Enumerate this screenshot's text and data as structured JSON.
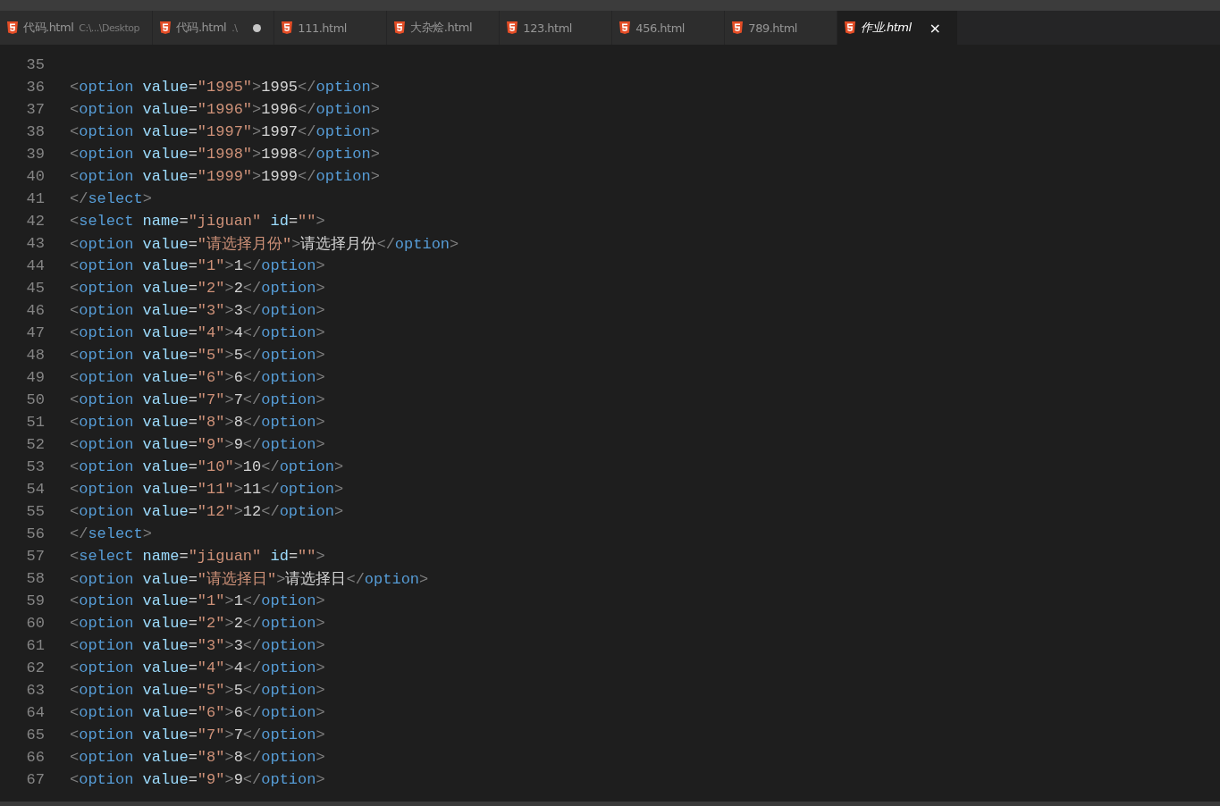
{
  "tabs": [
    {
      "label": "代码.html",
      "path": "C:\\...\\Desktop",
      "modified": false,
      "selected": false
    },
    {
      "label": "代码.html",
      "path": ".\\",
      "modified": true,
      "selected": false
    },
    {
      "label": "111.html",
      "modified": false,
      "selected": false
    },
    {
      "label": "大杂烩.html",
      "modified": false,
      "selected": false
    },
    {
      "label": "123.html",
      "modified": false,
      "selected": false
    },
    {
      "label": "456.html",
      "modified": false,
      "selected": false
    },
    {
      "label": "789.html",
      "modified": false,
      "selected": false
    },
    {
      "label": "作业.html",
      "modified": false,
      "selected": true,
      "close": "×"
    }
  ],
  "lines": [
    {
      "number": "35"
    },
    {
      "number": "36",
      "tokens": [
        {
          "kind": "punct",
          "text": "<"
        },
        {
          "kind": "tag",
          "text": "option"
        },
        {
          "kind": "attr",
          "text": " value"
        },
        {
          "kind": "eq",
          "text": "="
        },
        {
          "kind": "str",
          "text": "\"1995\""
        },
        {
          "kind": "punct",
          "text": ">"
        },
        {
          "kind": "text",
          "text": "1995"
        },
        {
          "kind": "punct",
          "text": "</"
        },
        {
          "kind": "tag",
          "text": "option"
        },
        {
          "kind": "punct",
          "text": ">"
        }
      ]
    },
    {
      "number": "37",
      "tokens": [
        {
          "kind": "punct",
          "text": "<"
        },
        {
          "kind": "tag",
          "text": "option"
        },
        {
          "kind": "attr",
          "text": " value"
        },
        {
          "kind": "eq",
          "text": "="
        },
        {
          "kind": "str",
          "text": "\"1996\""
        },
        {
          "kind": "punct",
          "text": ">"
        },
        {
          "kind": "text",
          "text": "1996"
        },
        {
          "kind": "punct",
          "text": "</"
        },
        {
          "kind": "tag",
          "text": "option"
        },
        {
          "kind": "punct",
          "text": ">"
        }
      ]
    },
    {
      "number": "38",
      "tokens": [
        {
          "kind": "punct",
          "text": "<"
        },
        {
          "kind": "tag",
          "text": "option"
        },
        {
          "kind": "attr",
          "text": " value"
        },
        {
          "kind": "eq",
          "text": "="
        },
        {
          "kind": "str",
          "text": "\"1997\""
        },
        {
          "kind": "punct",
          "text": ">"
        },
        {
          "kind": "text",
          "text": "1997"
        },
        {
          "kind": "punct",
          "text": "</"
        },
        {
          "kind": "tag",
          "text": "option"
        },
        {
          "kind": "punct",
          "text": ">"
        }
      ]
    },
    {
      "number": "39",
      "tokens": [
        {
          "kind": "punct",
          "text": "<"
        },
        {
          "kind": "tag",
          "text": "option"
        },
        {
          "kind": "attr",
          "text": " value"
        },
        {
          "kind": "eq",
          "text": "="
        },
        {
          "kind": "str",
          "text": "\"1998\""
        },
        {
          "kind": "punct",
          "text": ">"
        },
        {
          "kind": "text",
          "text": "1998"
        },
        {
          "kind": "punct",
          "text": "</"
        },
        {
          "kind": "tag",
          "text": "option"
        },
        {
          "kind": "punct",
          "text": ">"
        }
      ]
    },
    {
      "number": "40",
      "tokens": [
        {
          "kind": "punct",
          "text": "<"
        },
        {
          "kind": "tag",
          "text": "option"
        },
        {
          "kind": "attr",
          "text": " value"
        },
        {
          "kind": "eq",
          "text": "="
        },
        {
          "kind": "str",
          "text": "\"1999\""
        },
        {
          "kind": "punct",
          "text": ">"
        },
        {
          "kind": "text",
          "text": "1999"
        },
        {
          "kind": "punct",
          "text": "</"
        },
        {
          "kind": "tag",
          "text": "option"
        },
        {
          "kind": "punct",
          "text": ">"
        }
      ]
    },
    {
      "number": "41",
      "tokens": [
        {
          "kind": "punct",
          "text": "</"
        },
        {
          "kind": "tag",
          "text": "select"
        },
        {
          "kind": "punct",
          "text": ">"
        }
      ]
    },
    {
      "number": "42",
      "tokens": [
        {
          "kind": "punct",
          "text": "<"
        },
        {
          "kind": "tag",
          "text": "select"
        },
        {
          "kind": "attr",
          "text": " name"
        },
        {
          "kind": "eq",
          "text": "="
        },
        {
          "kind": "str",
          "text": "\"jiguan\""
        },
        {
          "kind": "attr",
          "text": " id"
        },
        {
          "kind": "eq",
          "text": "="
        },
        {
          "kind": "str",
          "text": "\"\""
        },
        {
          "kind": "punct",
          "text": ">"
        }
      ]
    },
    {
      "number": "43",
      "tokens": [
        {
          "kind": "punct",
          "text": "<"
        },
        {
          "kind": "tag",
          "text": "option"
        },
        {
          "kind": "attr",
          "text": " value"
        },
        {
          "kind": "eq",
          "text": "="
        },
        {
          "kind": "str",
          "text": "\"请选择月份\""
        },
        {
          "kind": "punct",
          "text": ">"
        },
        {
          "kind": "text",
          "text": "请选择月份"
        },
        {
          "kind": "punct",
          "text": "</"
        },
        {
          "kind": "tag",
          "text": "option"
        },
        {
          "kind": "punct",
          "text": ">"
        }
      ]
    },
    {
      "number": "44",
      "tokens": [
        {
          "kind": "punct",
          "text": "<"
        },
        {
          "kind": "tag",
          "text": "option"
        },
        {
          "kind": "attr",
          "text": " value"
        },
        {
          "kind": "eq",
          "text": "="
        },
        {
          "kind": "str",
          "text": "\"1\""
        },
        {
          "kind": "punct",
          "text": ">"
        },
        {
          "kind": "text",
          "text": "1"
        },
        {
          "kind": "punct",
          "text": "</"
        },
        {
          "kind": "tag",
          "text": "option"
        },
        {
          "kind": "punct",
          "text": ">"
        }
      ]
    },
    {
      "number": "45",
      "tokens": [
        {
          "kind": "punct",
          "text": "<"
        },
        {
          "kind": "tag",
          "text": "option"
        },
        {
          "kind": "attr",
          "text": " value"
        },
        {
          "kind": "eq",
          "text": "="
        },
        {
          "kind": "str",
          "text": "\"2\""
        },
        {
          "kind": "punct",
          "text": ">"
        },
        {
          "kind": "text",
          "text": "2"
        },
        {
          "kind": "punct",
          "text": "</"
        },
        {
          "kind": "tag",
          "text": "option"
        },
        {
          "kind": "punct",
          "text": ">"
        }
      ]
    },
    {
      "number": "46",
      "tokens": [
        {
          "kind": "punct",
          "text": "<"
        },
        {
          "kind": "tag",
          "text": "option"
        },
        {
          "kind": "attr",
          "text": " value"
        },
        {
          "kind": "eq",
          "text": "="
        },
        {
          "kind": "str",
          "text": "\"3\""
        },
        {
          "kind": "punct",
          "text": ">"
        },
        {
          "kind": "text",
          "text": "3"
        },
        {
          "kind": "punct",
          "text": "</"
        },
        {
          "kind": "tag",
          "text": "option"
        },
        {
          "kind": "punct",
          "text": ">"
        }
      ]
    },
    {
      "number": "47",
      "tokens": [
        {
          "kind": "punct",
          "text": "<"
        },
        {
          "kind": "tag",
          "text": "option"
        },
        {
          "kind": "attr",
          "text": " value"
        },
        {
          "kind": "eq",
          "text": "="
        },
        {
          "kind": "str",
          "text": "\"4\""
        },
        {
          "kind": "punct",
          "text": ">"
        },
        {
          "kind": "text",
          "text": "4"
        },
        {
          "kind": "punct",
          "text": "</"
        },
        {
          "kind": "tag",
          "text": "option"
        },
        {
          "kind": "punct",
          "text": ">"
        }
      ]
    },
    {
      "number": "48",
      "tokens": [
        {
          "kind": "punct",
          "text": "<"
        },
        {
          "kind": "tag",
          "text": "option"
        },
        {
          "kind": "attr",
          "text": " value"
        },
        {
          "kind": "eq",
          "text": "="
        },
        {
          "kind": "str",
          "text": "\"5\""
        },
        {
          "kind": "punct",
          "text": ">"
        },
        {
          "kind": "text",
          "text": "5"
        },
        {
          "kind": "punct",
          "text": "</"
        },
        {
          "kind": "tag",
          "text": "option"
        },
        {
          "kind": "punct",
          "text": ">"
        }
      ]
    },
    {
      "number": "49",
      "tokens": [
        {
          "kind": "punct",
          "text": "<"
        },
        {
          "kind": "tag",
          "text": "option"
        },
        {
          "kind": "attr",
          "text": " value"
        },
        {
          "kind": "eq",
          "text": "="
        },
        {
          "kind": "str",
          "text": "\"6\""
        },
        {
          "kind": "punct",
          "text": ">"
        },
        {
          "kind": "text",
          "text": "6"
        },
        {
          "kind": "punct",
          "text": "</"
        },
        {
          "kind": "tag",
          "text": "option"
        },
        {
          "kind": "punct",
          "text": ">"
        }
      ]
    },
    {
      "number": "50",
      "tokens": [
        {
          "kind": "punct",
          "text": "<"
        },
        {
          "kind": "tag",
          "text": "option"
        },
        {
          "kind": "attr",
          "text": " value"
        },
        {
          "kind": "eq",
          "text": "="
        },
        {
          "kind": "str",
          "text": "\"7\""
        },
        {
          "kind": "punct",
          "text": ">"
        },
        {
          "kind": "text",
          "text": "7"
        },
        {
          "kind": "punct",
          "text": "</"
        },
        {
          "kind": "tag",
          "text": "option"
        },
        {
          "kind": "punct",
          "text": ">"
        }
      ]
    },
    {
      "number": "51",
      "tokens": [
        {
          "kind": "punct",
          "text": "<"
        },
        {
          "kind": "tag",
          "text": "option"
        },
        {
          "kind": "attr",
          "text": " value"
        },
        {
          "kind": "eq",
          "text": "="
        },
        {
          "kind": "str",
          "text": "\"8\""
        },
        {
          "kind": "punct",
          "text": ">"
        },
        {
          "kind": "text",
          "text": "8"
        },
        {
          "kind": "punct",
          "text": "</"
        },
        {
          "kind": "tag",
          "text": "option"
        },
        {
          "kind": "punct",
          "text": ">"
        }
      ]
    },
    {
      "number": "52",
      "tokens": [
        {
          "kind": "punct",
          "text": "<"
        },
        {
          "kind": "tag",
          "text": "option"
        },
        {
          "kind": "attr",
          "text": " value"
        },
        {
          "kind": "eq",
          "text": "="
        },
        {
          "kind": "str",
          "text": "\"9\""
        },
        {
          "kind": "punct",
          "text": ">"
        },
        {
          "kind": "text",
          "text": "9"
        },
        {
          "kind": "punct",
          "text": "</"
        },
        {
          "kind": "tag",
          "text": "option"
        },
        {
          "kind": "punct",
          "text": ">"
        }
      ]
    },
    {
      "number": "53",
      "tokens": [
        {
          "kind": "punct",
          "text": "<"
        },
        {
          "kind": "tag",
          "text": "option"
        },
        {
          "kind": "attr",
          "text": " value"
        },
        {
          "kind": "eq",
          "text": "="
        },
        {
          "kind": "str",
          "text": "\"10\""
        },
        {
          "kind": "punct",
          "text": ">"
        },
        {
          "kind": "text",
          "text": "10"
        },
        {
          "kind": "punct",
          "text": "</"
        },
        {
          "kind": "tag",
          "text": "option"
        },
        {
          "kind": "punct",
          "text": ">"
        }
      ]
    },
    {
      "number": "54",
      "tokens": [
        {
          "kind": "punct",
          "text": "<"
        },
        {
          "kind": "tag",
          "text": "option"
        },
        {
          "kind": "attr",
          "text": " value"
        },
        {
          "kind": "eq",
          "text": "="
        },
        {
          "kind": "str",
          "text": "\"11\""
        },
        {
          "kind": "punct",
          "text": ">"
        },
        {
          "kind": "text",
          "text": "11"
        },
        {
          "kind": "punct",
          "text": "</"
        },
        {
          "kind": "tag",
          "text": "option"
        },
        {
          "kind": "punct",
          "text": ">"
        }
      ]
    },
    {
      "number": "55",
      "tokens": [
        {
          "kind": "punct",
          "text": "<"
        },
        {
          "kind": "tag",
          "text": "option"
        },
        {
          "kind": "attr",
          "text": " value"
        },
        {
          "kind": "eq",
          "text": "="
        },
        {
          "kind": "str",
          "text": "\"12\""
        },
        {
          "kind": "punct",
          "text": ">"
        },
        {
          "kind": "text",
          "text": "12"
        },
        {
          "kind": "punct",
          "text": "</"
        },
        {
          "kind": "tag",
          "text": "option"
        },
        {
          "kind": "punct",
          "text": ">"
        }
      ]
    },
    {
      "number": "56",
      "tokens": [
        {
          "kind": "punct",
          "text": "</"
        },
        {
          "kind": "tag",
          "text": "select"
        },
        {
          "kind": "punct",
          "text": ">"
        }
      ]
    },
    {
      "number": "57",
      "tokens": [
        {
          "kind": "punct",
          "text": "<"
        },
        {
          "kind": "tag",
          "text": "select"
        },
        {
          "kind": "attr",
          "text": " name"
        },
        {
          "kind": "eq",
          "text": "="
        },
        {
          "kind": "str",
          "text": "\"jiguan\""
        },
        {
          "kind": "attr",
          "text": " id"
        },
        {
          "kind": "eq",
          "text": "="
        },
        {
          "kind": "str",
          "text": "\"\""
        },
        {
          "kind": "punct",
          "text": ">"
        }
      ]
    },
    {
      "number": "58",
      "tokens": [
        {
          "kind": "punct",
          "text": "<"
        },
        {
          "kind": "tag",
          "text": "option"
        },
        {
          "kind": "attr",
          "text": " value"
        },
        {
          "kind": "eq",
          "text": "="
        },
        {
          "kind": "str",
          "text": "\"请选择日\""
        },
        {
          "kind": "punct",
          "text": ">"
        },
        {
          "kind": "text",
          "text": "请选择日"
        },
        {
          "kind": "punct",
          "text": "</"
        },
        {
          "kind": "tag",
          "text": "option"
        },
        {
          "kind": "punct",
          "text": ">"
        }
      ]
    },
    {
      "number": "59",
      "tokens": [
        {
          "kind": "punct",
          "text": "<"
        },
        {
          "kind": "tag",
          "text": "option"
        },
        {
          "kind": "attr",
          "text": " value"
        },
        {
          "kind": "eq",
          "text": "="
        },
        {
          "kind": "str",
          "text": "\"1\""
        },
        {
          "kind": "punct",
          "text": ">"
        },
        {
          "kind": "text",
          "text": "1"
        },
        {
          "kind": "punct",
          "text": "</"
        },
        {
          "kind": "tag",
          "text": "option"
        },
        {
          "kind": "punct",
          "text": ">"
        }
      ]
    },
    {
      "number": "60",
      "tokens": [
        {
          "kind": "punct",
          "text": "<"
        },
        {
          "kind": "tag",
          "text": "option"
        },
        {
          "kind": "attr",
          "text": " value"
        },
        {
          "kind": "eq",
          "text": "="
        },
        {
          "kind": "str",
          "text": "\"2\""
        },
        {
          "kind": "punct",
          "text": ">"
        },
        {
          "kind": "text",
          "text": "2"
        },
        {
          "kind": "punct",
          "text": "</"
        },
        {
          "kind": "tag",
          "text": "option"
        },
        {
          "kind": "punct",
          "text": ">"
        }
      ]
    },
    {
      "number": "61",
      "tokens": [
        {
          "kind": "punct",
          "text": "<"
        },
        {
          "kind": "tag",
          "text": "option"
        },
        {
          "kind": "attr",
          "text": " value"
        },
        {
          "kind": "eq",
          "text": "="
        },
        {
          "kind": "str",
          "text": "\"3\""
        },
        {
          "kind": "punct",
          "text": ">"
        },
        {
          "kind": "text",
          "text": "3"
        },
        {
          "kind": "punct",
          "text": "</"
        },
        {
          "kind": "tag",
          "text": "option"
        },
        {
          "kind": "punct",
          "text": ">"
        }
      ]
    },
    {
      "number": "62",
      "tokens": [
        {
          "kind": "punct",
          "text": "<"
        },
        {
          "kind": "tag",
          "text": "option"
        },
        {
          "kind": "attr",
          "text": " value"
        },
        {
          "kind": "eq",
          "text": "="
        },
        {
          "kind": "str",
          "text": "\"4\""
        },
        {
          "kind": "punct",
          "text": ">"
        },
        {
          "kind": "text",
          "text": "4"
        },
        {
          "kind": "punct",
          "text": "</"
        },
        {
          "kind": "tag",
          "text": "option"
        },
        {
          "kind": "punct",
          "text": ">"
        }
      ]
    },
    {
      "number": "63",
      "tokens": [
        {
          "kind": "punct",
          "text": "<"
        },
        {
          "kind": "tag",
          "text": "option"
        },
        {
          "kind": "attr",
          "text": " value"
        },
        {
          "kind": "eq",
          "text": "="
        },
        {
          "kind": "str",
          "text": "\"5\""
        },
        {
          "kind": "punct",
          "text": ">"
        },
        {
          "kind": "text",
          "text": "5"
        },
        {
          "kind": "punct",
          "text": "</"
        },
        {
          "kind": "tag",
          "text": "option"
        },
        {
          "kind": "punct",
          "text": ">"
        }
      ]
    },
    {
      "number": "64",
      "tokens": [
        {
          "kind": "punct",
          "text": "<"
        },
        {
          "kind": "tag",
          "text": "option"
        },
        {
          "kind": "attr",
          "text": " value"
        },
        {
          "kind": "eq",
          "text": "="
        },
        {
          "kind": "str",
          "text": "\"6\""
        },
        {
          "kind": "punct",
          "text": ">"
        },
        {
          "kind": "text",
          "text": "6"
        },
        {
          "kind": "punct",
          "text": "</"
        },
        {
          "kind": "tag",
          "text": "option"
        },
        {
          "kind": "punct",
          "text": ">"
        }
      ]
    },
    {
      "number": "65",
      "tokens": [
        {
          "kind": "punct",
          "text": "<"
        },
        {
          "kind": "tag",
          "text": "option"
        },
        {
          "kind": "attr",
          "text": " value"
        },
        {
          "kind": "eq",
          "text": "="
        },
        {
          "kind": "str",
          "text": "\"7\""
        },
        {
          "kind": "punct",
          "text": ">"
        },
        {
          "kind": "text",
          "text": "7"
        },
        {
          "kind": "punct",
          "text": "</"
        },
        {
          "kind": "tag",
          "text": "option"
        },
        {
          "kind": "punct",
          "text": ">"
        }
      ]
    },
    {
      "number": "66",
      "tokens": [
        {
          "kind": "punct",
          "text": "<"
        },
        {
          "kind": "tag",
          "text": "option"
        },
        {
          "kind": "attr",
          "text": " value"
        },
        {
          "kind": "eq",
          "text": "="
        },
        {
          "kind": "str",
          "text": "\"8\""
        },
        {
          "kind": "punct",
          "text": ">"
        },
        {
          "kind": "text",
          "text": "8"
        },
        {
          "kind": "punct",
          "text": "</"
        },
        {
          "kind": "tag",
          "text": "option"
        },
        {
          "kind": "punct",
          "text": ">"
        }
      ]
    },
    {
      "number": "67",
      "tokens": [
        {
          "kind": "punct",
          "text": "<"
        },
        {
          "kind": "tag",
          "text": "option"
        },
        {
          "kind": "attr",
          "text": " value"
        },
        {
          "kind": "eq",
          "text": "="
        },
        {
          "kind": "str",
          "text": "\"9\""
        },
        {
          "kind": "punct",
          "text": ">"
        },
        {
          "kind": "text",
          "text": "9"
        },
        {
          "kind": "punct",
          "text": "</"
        },
        {
          "kind": "tag",
          "text": "option"
        },
        {
          "kind": "punct",
          "text": ">"
        }
      ]
    }
  ]
}
